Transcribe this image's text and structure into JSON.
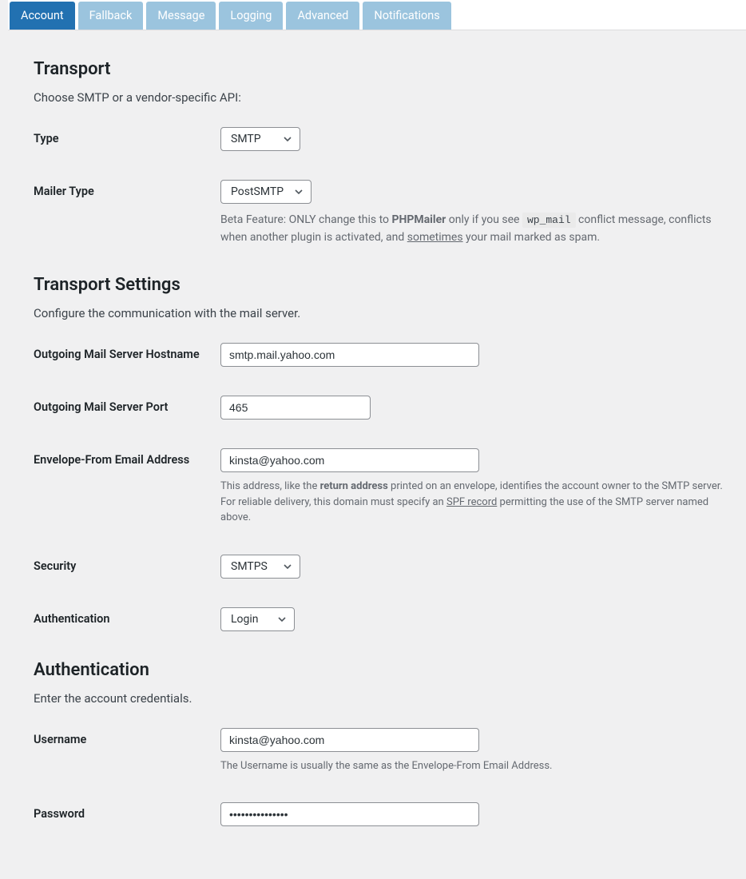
{
  "tabs": {
    "account": "Account",
    "fallback": "Fallback",
    "message": "Message",
    "logging": "Logging",
    "advanced": "Advanced",
    "notifications": "Notifications"
  },
  "transport": {
    "heading": "Transport",
    "desc": "Choose SMTP or a vendor-specific API:",
    "type_label": "Type",
    "type_value": "SMTP",
    "mailer_type_label": "Mailer Type",
    "mailer_type_value": "PostSMTP",
    "mailer_hint_prefix": "Beta Feature: ONLY change this to ",
    "mailer_hint_bold": "PHPMailer",
    "mailer_hint_mid": " only if you see ",
    "mailer_hint_code": "wp_mail",
    "mailer_hint_mid2": " conflict message, conflicts when another plugin is activated, and ",
    "mailer_hint_underline": "sometimes",
    "mailer_hint_suffix": " your mail marked as spam."
  },
  "settings": {
    "heading": "Transport Settings",
    "desc": "Configure the communication with the mail server.",
    "hostname_label": "Outgoing Mail Server Hostname",
    "hostname_value": "smtp.mail.yahoo.com",
    "port_label": "Outgoing Mail Server Port",
    "port_value": "465",
    "envelope_label": "Envelope-From Email Address",
    "envelope_value": "kinsta@yahoo.com",
    "envelope_hint_prefix": "This address, like the ",
    "envelope_hint_bold": "return address",
    "envelope_hint_mid": " printed on an envelope, identifies the account owner to the SMTP server. For reliable delivery, this domain must specify an ",
    "envelope_hint_link": "SPF record",
    "envelope_hint_suffix": " permitting the use of the SMTP server named above.",
    "security_label": "Security",
    "security_value": "SMTPS",
    "auth_label": "Authentication",
    "auth_value": "Login"
  },
  "auth": {
    "heading": "Authentication",
    "desc": "Enter the account credentials.",
    "username_label": "Username",
    "username_value": "kinsta@yahoo.com",
    "username_hint": "The Username is usually the same as the Envelope-From Email Address.",
    "password_label": "Password",
    "password_value": "•••••••••••••••"
  }
}
